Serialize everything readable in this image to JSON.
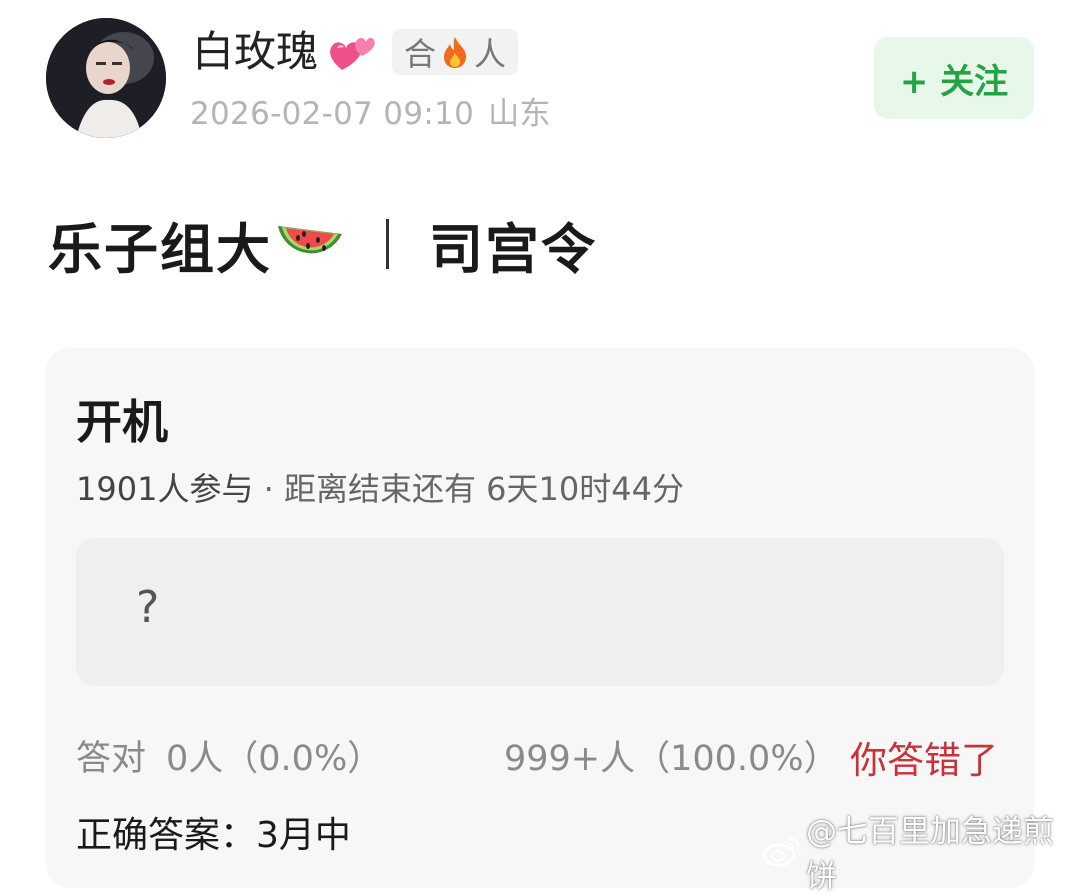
{
  "post": {
    "username": "白玫瑰",
    "badge_left": "合",
    "badge_right": "人",
    "datetime": "2026-02-07 09:10",
    "location": "山东",
    "follow_label": "+ 关注",
    "title_text": "乐子组大",
    "title_subject": "司宫令"
  },
  "quiz": {
    "title": "开机",
    "participants": "1901人参与",
    "countdown": " · 距离结束还有 6天10时44分",
    "answer_placeholder": "?",
    "correct_label": "答对",
    "correct_stats": "0人（0.0%）",
    "wrong_stats": "999+人（100.0%）",
    "result": "你答错了",
    "answer_text": "正确答案：3月中"
  },
  "watermark": "@七百里加急递煎饼",
  "icons": [
    "avatar",
    "two-hearts-icon",
    "fire-icon",
    "watermelon-icon",
    "weibo-logo-icon"
  ],
  "colors": {
    "follow_green": "#25a244",
    "follow_bg": "#e7f7ea",
    "wrong_red": "#c8323a",
    "card_bg": "#f7f7f7"
  }
}
